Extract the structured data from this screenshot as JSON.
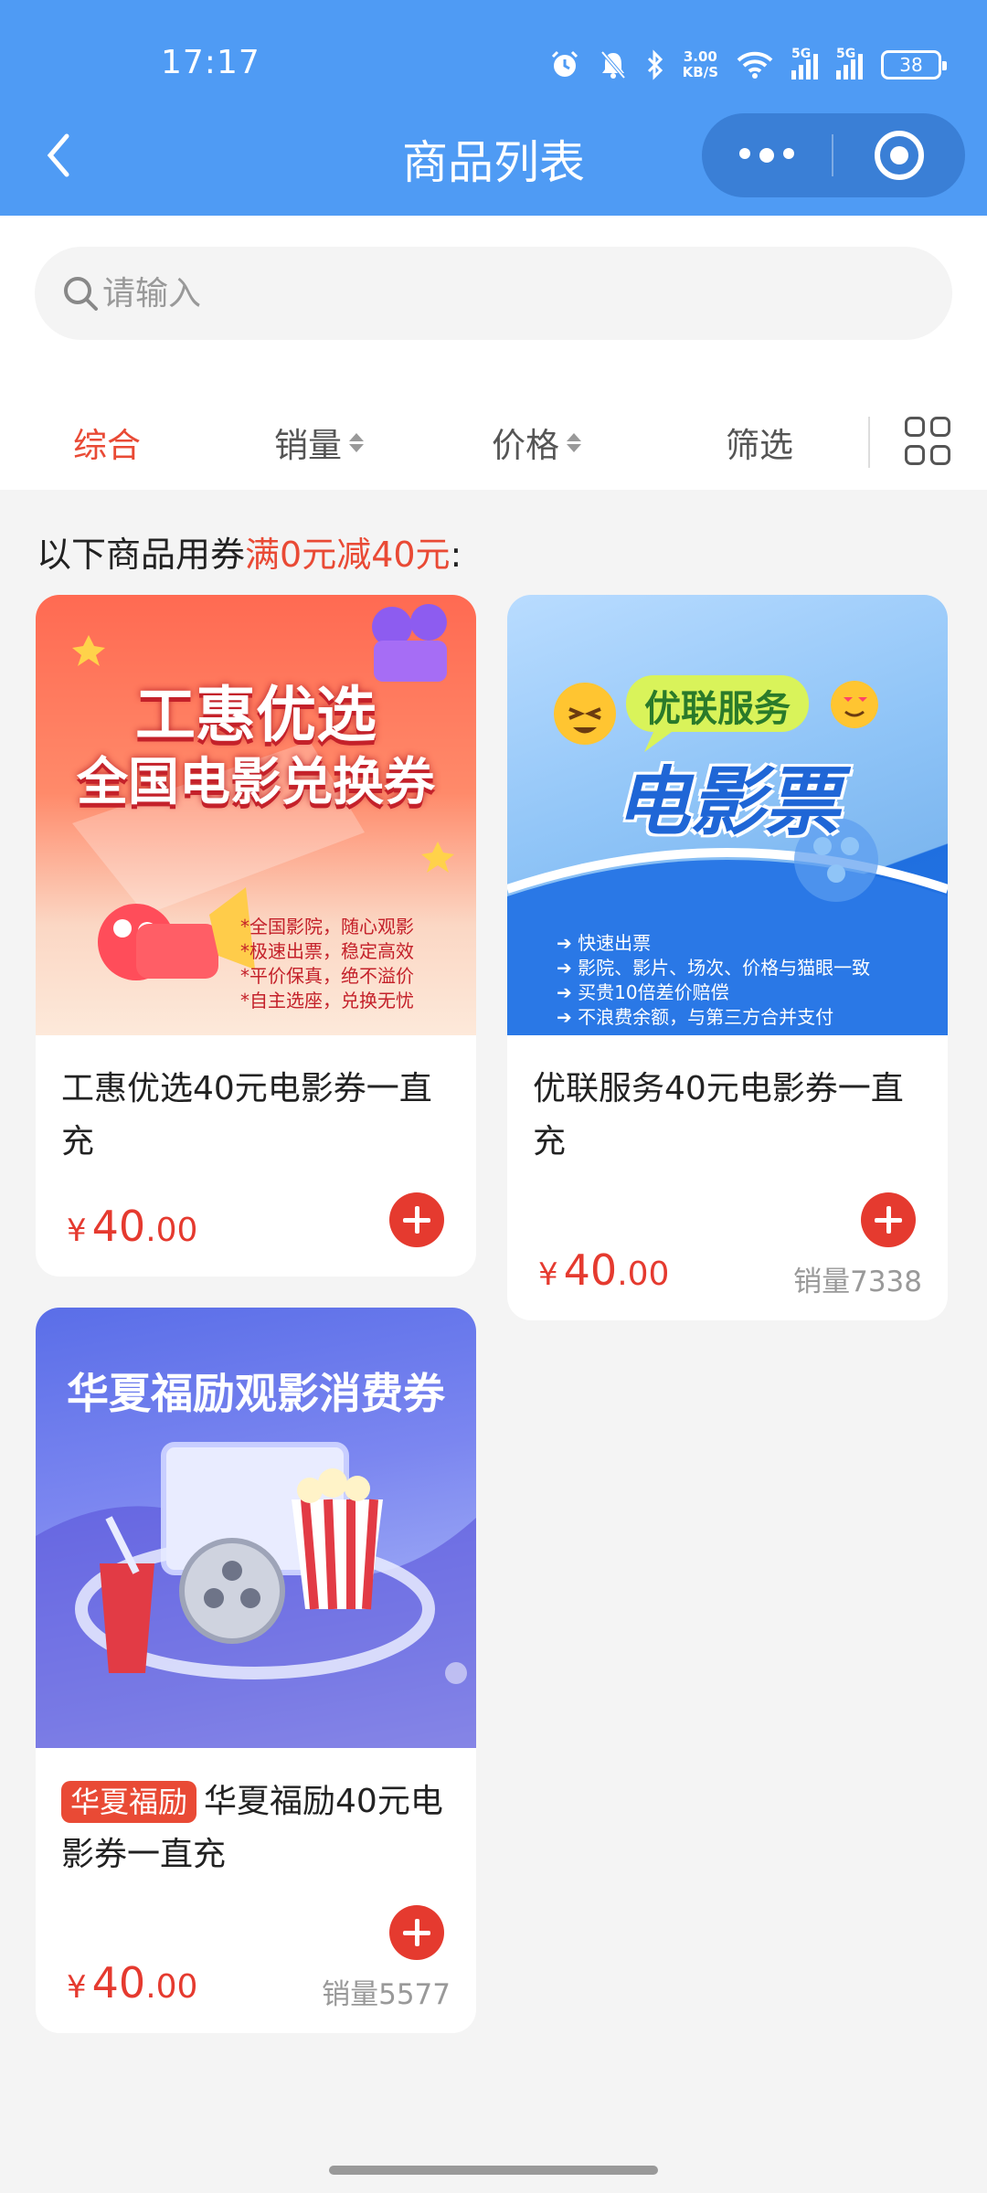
{
  "status_bar": {
    "time": "17:17",
    "net_speed_value": "3.00",
    "net_speed_unit": "KB/S",
    "signal_1_label": "5G",
    "signal_2_label": "5G",
    "battery": "38"
  },
  "nav": {
    "title": "商品列表"
  },
  "search": {
    "placeholder": "请输入"
  },
  "filters": {
    "comprehensive": "综合",
    "sales": "销量",
    "price": "价格",
    "screen": "筛选"
  },
  "coupon": {
    "prefix": "以下商品用券",
    "highlight": "满0元减40元",
    "suffix": ":"
  },
  "products": [
    {
      "name": "工惠优选40元电影券一直充",
      "price_yen": "¥",
      "price_int": "40",
      "price_dec": ".00",
      "image": {
        "headline1": "工惠优选",
        "headline2": "全国电影兑换券",
        "points": [
          "*全国影院，随心观影",
          "*极速出票，稳定高效",
          "*平价保真，绝不溢价",
          "*自主选座，兑换无忧"
        ]
      }
    },
    {
      "name": "优联服务40元电影券一直充",
      "price_yen": "¥",
      "price_int": "40",
      "price_dec": ".00",
      "sales": "销量7338",
      "image": {
        "badge": "优联服务",
        "headline": "电影票",
        "points": [
          "快速出票",
          "影院、影片、场次、价格与猫眼一致",
          "买贵10倍差价赔偿",
          "不浪费余额，与第三方合并支付"
        ]
      }
    },
    {
      "brand_tag": "华夏福励",
      "name": "华夏福励40元电影券一直充",
      "price_yen": "¥",
      "price_int": "40",
      "price_dec": ".00",
      "sales": "销量5577",
      "image": {
        "headline": "华夏福励观影消费券"
      }
    }
  ]
}
